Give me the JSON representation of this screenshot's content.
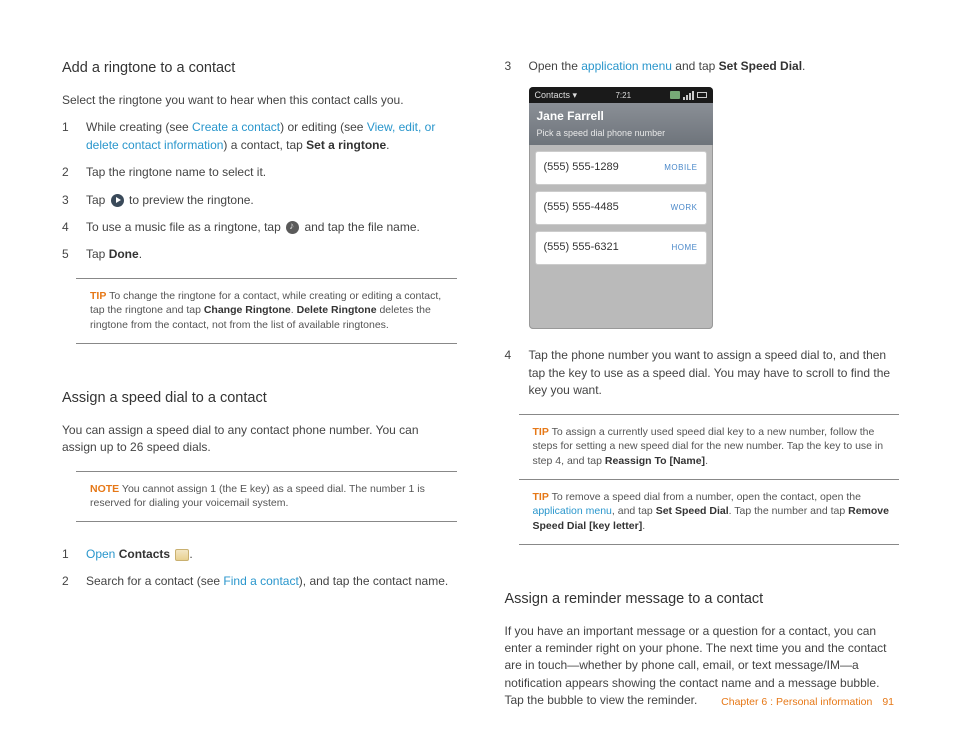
{
  "left": {
    "h1": "Add a ringtone to a contact",
    "intro": "Select the ringtone you want to hear when this contact calls you.",
    "s1a": "While creating (see ",
    "s1link1": "Create a contact",
    "s1b": ") or editing (see ",
    "s1link2": "View, edit, or delete contact information",
    "s1c": ") a contact, tap ",
    "s1bold": "Set a ringtone",
    "s1d": ".",
    "s2": "Tap the ringtone name to select it.",
    "s3a": "Tap ",
    "s3b": " to preview the ringtone.",
    "s4a": "To use a music file as a ringtone, tap ",
    "s4b": " and tap the file name.",
    "s5a": "Tap ",
    "s5bold": "Done",
    "s5b": ".",
    "tip1label": "TIP",
    "tip1a": "  To change the ringtone for a contact, while creating or editing a contact, tap the ringtone and tap ",
    "tip1b1": "Change Ringtone",
    "tip1mid": ". ",
    "tip1b2": "Delete Ringtone",
    "tip1c": " deletes the ringtone from the contact, not from the list of available ringtones.",
    "h2": "Assign a speed dial to a contact",
    "p2": "You can assign a speed dial to any contact phone number. You can assign up to 26 speed dials.",
    "notelabel": "NOTE",
    "note": "  You cannot assign 1 (the E key) as a speed dial. The number 1 is reserved for dialing your voicemail system.",
    "b1a": "Open ",
    "b1bold": "Contacts",
    "b1b": " ",
    "b1c": ".",
    "b2a": "Search for a contact (see ",
    "b2link": "Find a contact",
    "b2b": "), and tap the contact name."
  },
  "right": {
    "s3a": "Open the ",
    "s3link": "application menu",
    "s3b": " and tap ",
    "s3bold": "Set Speed Dial",
    "s3c": ".",
    "phone": {
      "app": "Contacts",
      "time": "7:21",
      "name": "Jane Farrell",
      "sub": "Pick a speed dial phone number",
      "rows": [
        {
          "num": "(555) 555-1289",
          "lab": "MOBILE"
        },
        {
          "num": "(555) 555-4485",
          "lab": "WORK"
        },
        {
          "num": "(555) 555-6321",
          "lab": "HOME"
        }
      ]
    },
    "s4": "Tap the phone number you want to assign a speed dial to, and then tap the key to use as a speed dial. You may have to scroll to find the key you want.",
    "tipAlabel": "TIP",
    "tipA1": "  To assign a currently used speed dial key to a new number, follow the steps for setting a new speed dial for the new number. Tap the key to use in step 4, and tap ",
    "tipAbold": "Reassign To [Name]",
    "tipA2": ".",
    "tipBlabel": "TIP",
    "tipB1": "  To remove a speed dial from a number, open the contact, open the ",
    "tipBlink": "application menu",
    "tipB2": ", and tap ",
    "tipBbold1": "Set Speed Dial",
    "tipB3": ". Tap the number and tap ",
    "tipBbold2": "Remove Speed Dial [key letter]",
    "tipB4": ".",
    "h3": "Assign a reminder message to a contact",
    "p3": "If you have an important message or a question for a contact, you can enter a reminder right on your phone. The next time you and the contact are in touch—whether by phone call, email, or text message/IM—a notification appears showing the contact name and a message bubble. Tap the bubble to view the reminder."
  },
  "footer": {
    "chapter": "Chapter 6 : Personal information",
    "page": "91"
  }
}
